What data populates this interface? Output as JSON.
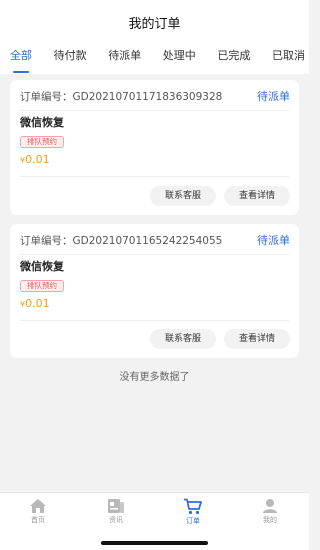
{
  "header": {
    "title": "我的订单"
  },
  "tabs": [
    {
      "label": "全部",
      "active": true
    },
    {
      "label": "待付款",
      "active": false
    },
    {
      "label": "待派单",
      "active": false
    },
    {
      "label": "处理中",
      "active": false
    },
    {
      "label": "已完成",
      "active": false
    },
    {
      "label": "已取消",
      "active": false
    }
  ],
  "orders": [
    {
      "order_label": "订单编号：",
      "order_no": "GD20210701171836309328",
      "status": "待派单",
      "service": "微信恢复",
      "tag": "排队预约",
      "currency": "¥",
      "price": "0.01",
      "contact_label": "联系客服",
      "detail_label": "查看详情"
    },
    {
      "order_label": "订单编号：",
      "order_no": "GD20210701165242254055",
      "status": "待派单",
      "service": "微信恢复",
      "tag": "排队预约",
      "currency": "¥",
      "price": "0.01",
      "contact_label": "联系客服",
      "detail_label": "查看详情"
    }
  ],
  "no_more_text": "没有更多数据了",
  "tabbar": {
    "items": [
      {
        "label": "首页",
        "icon": "home-icon",
        "active": false
      },
      {
        "label": "资讯",
        "icon": "news-icon",
        "active": false
      },
      {
        "label": "订单",
        "icon": "cart-icon",
        "active": true
      },
      {
        "label": "我的",
        "icon": "user-icon",
        "active": false
      }
    ]
  },
  "colors": {
    "accent": "#2f6fd8",
    "price": "#f0a020",
    "tag_text": "#e25c5c",
    "background": "#f2f2f2"
  }
}
